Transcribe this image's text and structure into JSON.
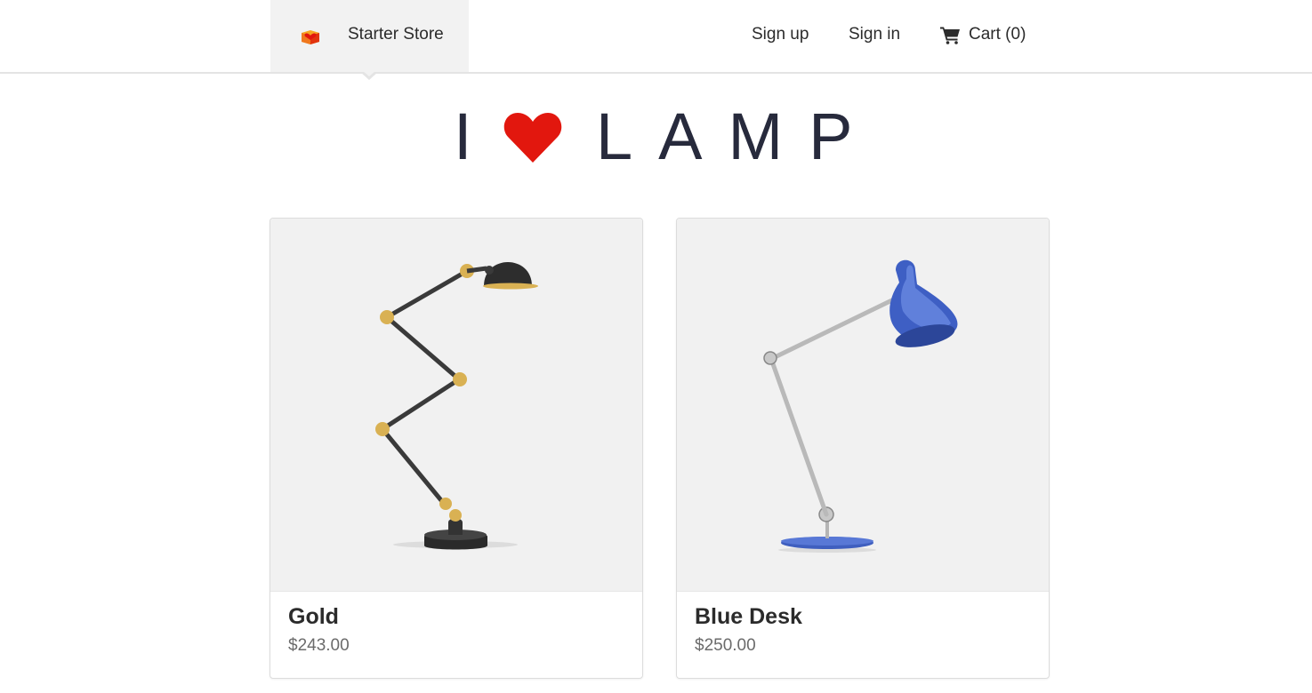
{
  "navbar": {
    "brand_name": "Starter Store",
    "brand_logo_icon": "store-logo-icon",
    "links": {
      "sign_up": "Sign up",
      "sign_in": "Sign in"
    },
    "cart": {
      "icon": "cart-icon",
      "label": "Cart (0)"
    }
  },
  "hero": {
    "before_heart": "I",
    "heart_icon": "heart-icon",
    "after_heart": "LAMP",
    "heart_color": "#e2170e"
  },
  "products": [
    {
      "name": "Gold",
      "price": "$243.00",
      "image_icon": "gold-lamp-image"
    },
    {
      "name": "Blue Desk",
      "price": "$250.00",
      "image_icon": "blue-desk-lamp-image"
    }
  ]
}
